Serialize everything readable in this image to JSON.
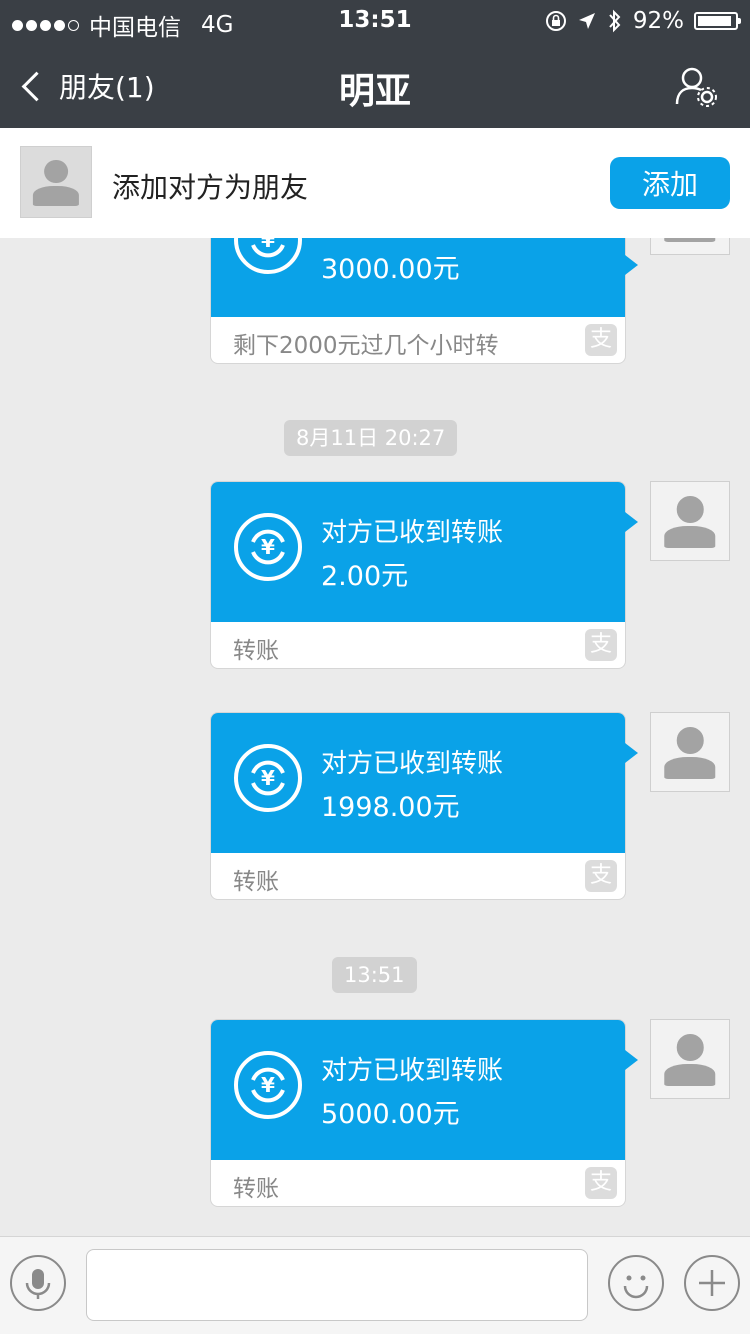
{
  "status_bar": {
    "carrier": "中国电信",
    "network": "4G",
    "time": "13:51",
    "battery": "92%",
    "battery_level": 0.92
  },
  "nav": {
    "back_label": "朋友(1)",
    "title": "明亚"
  },
  "add_friend_bar": {
    "text": "添加对方为朋友",
    "button_label": "添加"
  },
  "messages": [
    {
      "amount": "3000.00元",
      "footer": "剩下2000元过几个小时转"
    },
    {
      "title": "对方已收到转账",
      "amount": "2.00元",
      "footer": "转账"
    },
    {
      "title": "对方已收到转账",
      "amount": "1998.00元",
      "footer": "转账"
    },
    {
      "title": "对方已收到转账",
      "amount": "5000.00元",
      "footer": "转账"
    }
  ],
  "timestamps": [
    "8月11日 20:27",
    "13:51"
  ],
  "alipay_glyph": "支",
  "colors": {
    "nav_bg": "#3a3f45",
    "accent_blue": "#0aa2e8",
    "chat_bg": "#ebebeb"
  }
}
